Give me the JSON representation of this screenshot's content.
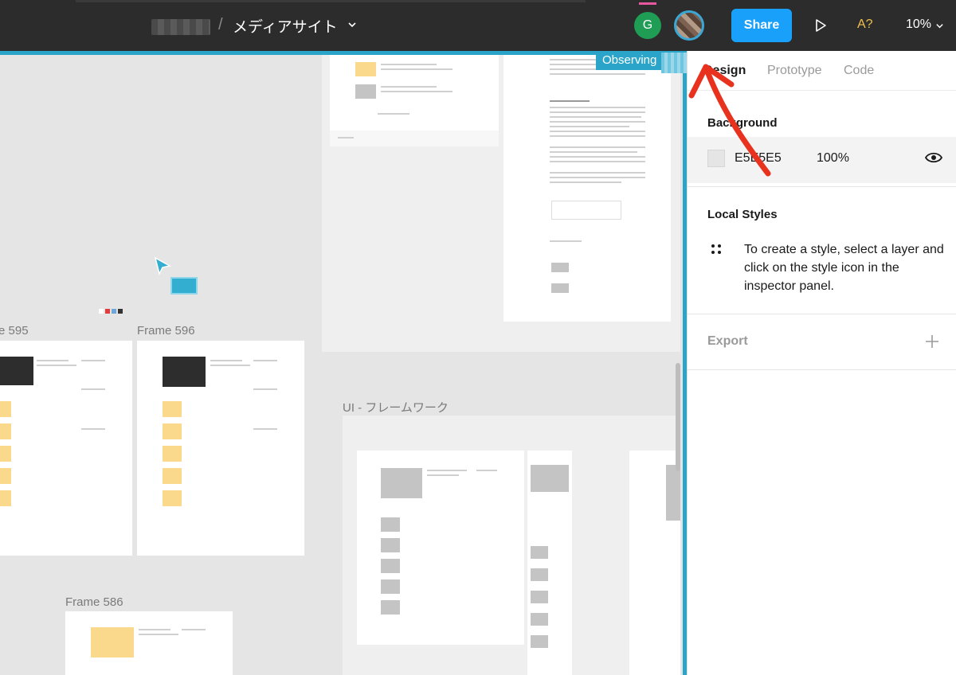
{
  "toolbar": {
    "file_name": "メディアサイト",
    "avatar_initial": "G",
    "share_label": "Share",
    "a11y_label": "A?",
    "zoom_label": "10%"
  },
  "observing": {
    "label": "Observing"
  },
  "canvas": {
    "frames": {
      "f595": "e 595",
      "f596": "Frame 596",
      "f586": "Frame 586",
      "ui_framework": "UI - フレームワーク"
    }
  },
  "panel": {
    "tabs": {
      "design": "Design",
      "prototype": "Prototype",
      "code": "Code"
    },
    "background": {
      "title": "Background",
      "hex": "E5E5E5",
      "opacity": "100%",
      "color": "#E5E5E5"
    },
    "local_styles": {
      "title": "Local Styles",
      "message": "To create a style, select a layer and click on the style icon in the inspector panel."
    },
    "export": {
      "title": "Export"
    }
  },
  "colors": {
    "toolbar_bg": "#2C2C2C",
    "share_blue": "#18A0FB",
    "observe_teal": "#2AA5C9",
    "annotation_red": "#E8321E"
  }
}
